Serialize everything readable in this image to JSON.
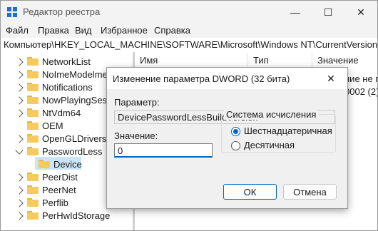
{
  "window": {
    "title": "Редактор реестра",
    "minimize_glyph": "—",
    "maximize_glyph": "☐",
    "close_glyph": "✕"
  },
  "menu": [
    "Файл",
    "Правка",
    "Вид",
    "Избранное",
    "Справка"
  ],
  "address": "Компьютер\\HKEY_LOCAL_MACHINE\\SOFTWARE\\Microsoft\\Windows NT\\CurrentVersion\\Passwo",
  "tree": {
    "items": [
      {
        "label": "NetworkList"
      },
      {
        "label": "NoImeModelmes"
      },
      {
        "label": "Notifications"
      },
      {
        "label": "NowPlayingSessio"
      },
      {
        "label": "NtVdm64"
      },
      {
        "label": "OEM"
      },
      {
        "label": "OpenGLDrivers"
      },
      {
        "label": "PasswordLess"
      },
      {
        "label": "Device"
      },
      {
        "label": "PeerDist"
      },
      {
        "label": "PeerNet"
      },
      {
        "label": "Perflib"
      },
      {
        "label": "PerHwIdStorage"
      }
    ]
  },
  "list": {
    "columns": [
      "Имя",
      "Тип",
      "Значение"
    ],
    "partial_values": [
      "ние не пр",
      "0002 (2)"
    ]
  },
  "dialog": {
    "title": "Изменение параметра DWORD (32 бита)",
    "close_glyph": "✕",
    "param_label": "Параметр:",
    "param_value": "DevicePasswordLessBuildVersion",
    "value_label": "Значение:",
    "value": "0",
    "base_group_title": "Система исчисления",
    "base_options": [
      "Шестнадцатеричная",
      "Десятичная"
    ],
    "base_selected": "Шестнадцатеричная",
    "ok_label": "ОК",
    "cancel_label": "Отмена"
  },
  "colors": {
    "accent": "#0067c0",
    "folder": "#f6cb5b",
    "selection": "#cce4f7"
  }
}
